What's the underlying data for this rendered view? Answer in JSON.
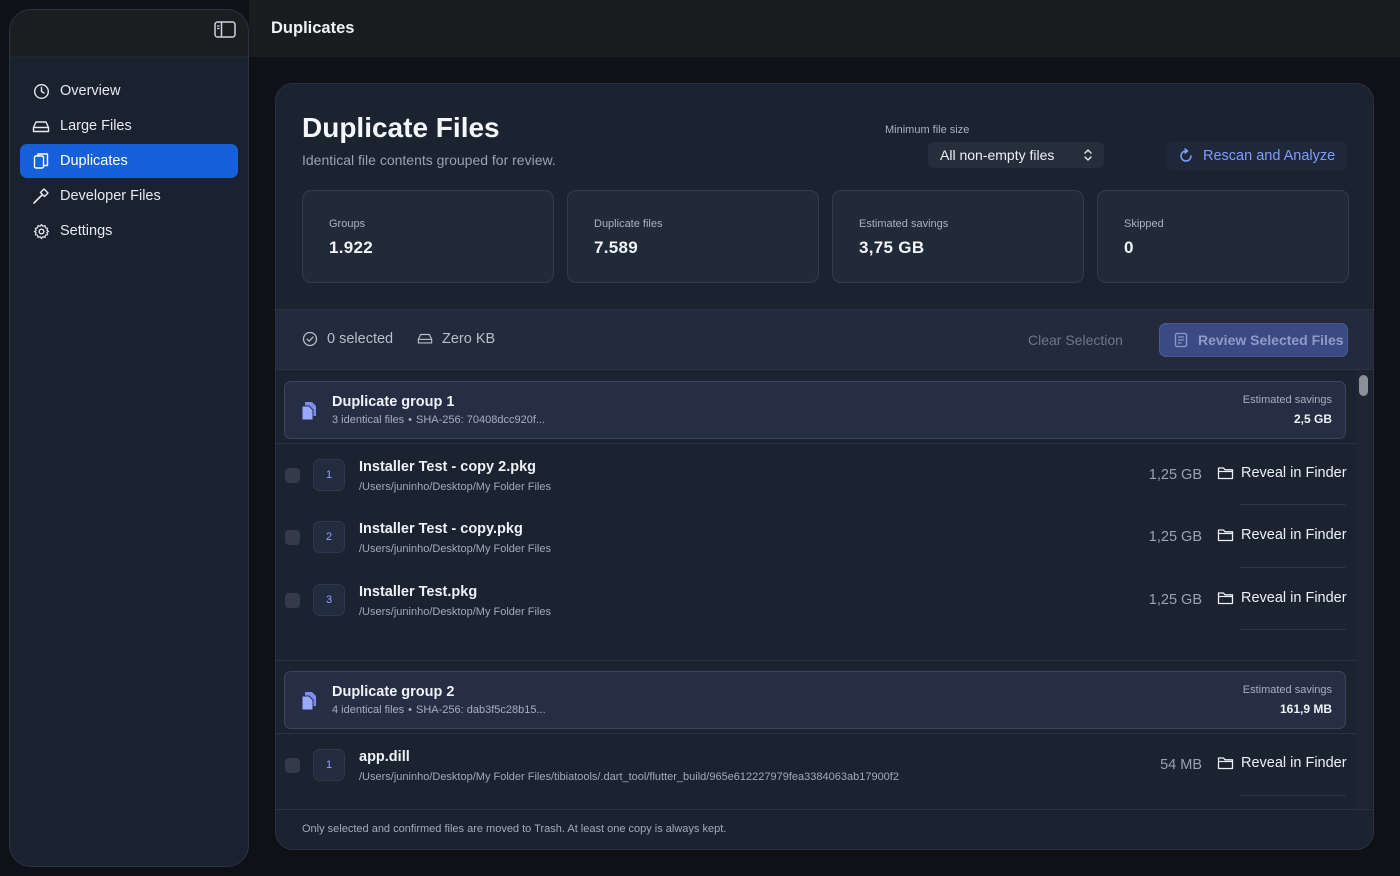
{
  "window": {
    "title": "Duplicates"
  },
  "sidebar": {
    "items": [
      {
        "label": "Overview",
        "icon": "clock-icon"
      },
      {
        "label": "Large Files",
        "icon": "drive-icon"
      },
      {
        "label": "Duplicates",
        "icon": "duplicate-icon",
        "active": true
      },
      {
        "label": "Developer Files",
        "icon": "hammer-icon"
      },
      {
        "label": "Settings",
        "icon": "gear-icon"
      }
    ]
  },
  "header": {
    "title": "Duplicate Files",
    "subtitle": "Identical file contents grouped for review.",
    "min_size_label": "Minimum file size",
    "min_size_value": "All non-empty files",
    "rescan_label": "Rescan and Analyze"
  },
  "stats": [
    {
      "label": "Groups",
      "value": "1.922"
    },
    {
      "label": "Duplicate files",
      "value": "7.589"
    },
    {
      "label": "Estimated savings",
      "value": "3,75 GB"
    },
    {
      "label": "Skipped",
      "value": "0"
    }
  ],
  "selection": {
    "count_text": "0 selected",
    "size_text": "Zero KB",
    "clear_label": "Clear Selection",
    "review_label": "Review Selected Files"
  },
  "groups": [
    {
      "title": "Duplicate group 1",
      "count_text": "3 identical files",
      "hash_text": "SHA-256: 70408dcc920f...",
      "savings_label": "Estimated savings",
      "savings_value": "2,5 GB",
      "files": [
        {
          "index": "1",
          "name": "Installer Test - copy 2.pkg",
          "path": "/Users/juninho/Desktop/My Folder Files",
          "size": "1,25 GB",
          "reveal_label": "Reveal in Finder"
        },
        {
          "index": "2",
          "name": "Installer Test - copy.pkg",
          "path": "/Users/juninho/Desktop/My Folder Files",
          "size": "1,25 GB",
          "reveal_label": "Reveal in Finder"
        },
        {
          "index": "3",
          "name": "Installer Test.pkg",
          "path": "/Users/juninho/Desktop/My Folder Files",
          "size": "1,25 GB",
          "reveal_label": "Reveal in Finder"
        }
      ]
    },
    {
      "title": "Duplicate group 2",
      "count_text": "4 identical files",
      "hash_text": "SHA-256: dab3f5c28b15...",
      "savings_label": "Estimated savings",
      "savings_value": "161,9 MB",
      "files": [
        {
          "index": "1",
          "name": "app.dill",
          "path": "/Users/juninho/Desktop/My Folder Files/tibiatools/.dart_tool/flutter_build/965e612227979fea3384063ab17900f2",
          "size": "54 MB",
          "reveal_label": "Reveal in Finder"
        }
      ]
    }
  ],
  "footer": {
    "note": "Only selected and confirmed files are moved to Trash. At least one copy is always kept."
  },
  "colors": {
    "accent": "#1661d9",
    "link": "#7f9dff",
    "background": "#0f1116",
    "card": "#1b2230"
  }
}
